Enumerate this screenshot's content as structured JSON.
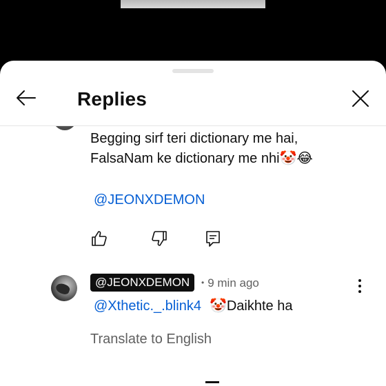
{
  "header": {
    "title": "Replies",
    "back_icon": "arrow-left-icon",
    "close_icon": "close-icon"
  },
  "parent_comment": {
    "text_line1": "Begging sirf teri dictionary me hai,",
    "text_line2": "FalsaNam ke dictionary me nhi",
    "emojis": "🤡😂",
    "mention": "@JEONXDEMON",
    "actions": {
      "like_icon": "thumbs-up-icon",
      "dislike_icon": "thumbs-down-icon",
      "reply_icon": "reply-comment-icon"
    }
  },
  "reply": {
    "author": "@JEONXDEMON",
    "separator": "•",
    "time": "9 min ago",
    "mention": "@Xthetic._.blink4",
    "emoji": "🤡",
    "text": "Daikhte ha",
    "translate_label": "Translate to English",
    "more_icon": "more-vertical-icon"
  },
  "colors": {
    "link": "#065fd4",
    "secondary_text": "#606060",
    "chip_bg": "#0f0f0f",
    "backdrop": "#000000"
  }
}
